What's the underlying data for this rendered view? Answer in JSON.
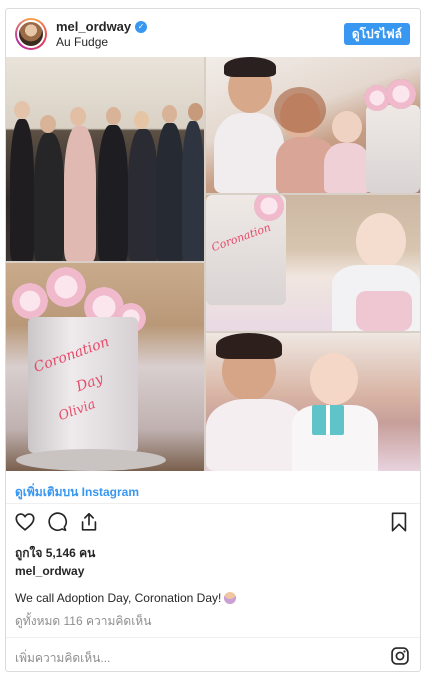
{
  "header": {
    "username": "mel_ordway",
    "location": "Au Fudge",
    "profile_button": "ดูโปรไฟล์"
  },
  "view_more": "ดูเพิ่มเติมบน Instagram",
  "likes": "ถูกใจ 5,146 คน",
  "caption_user": "mel_ordway",
  "caption": "We call Adoption Day, Coronation Day!",
  "comments_link": "ดูทั้งหมด 116 ความคิดเห็น",
  "comment_placeholder": "เพิ่มความคิดเห็น...",
  "icons": {
    "verified": "verified-badge-icon",
    "like": "heart-icon",
    "comment": "comment-icon",
    "share": "share-icon",
    "save": "bookmark-icon",
    "instagram": "instagram-icon",
    "caption_emoji": "princess-emoji-icon"
  },
  "colors": {
    "accent": "#3897f0",
    "text": "#262626",
    "muted": "#8e8e8e",
    "border": "#dbdbdb"
  },
  "photos": {
    "cake_text_1": "Coronation",
    "cake_text_2": "Day",
    "cake_text_3": "Olivia"
  }
}
